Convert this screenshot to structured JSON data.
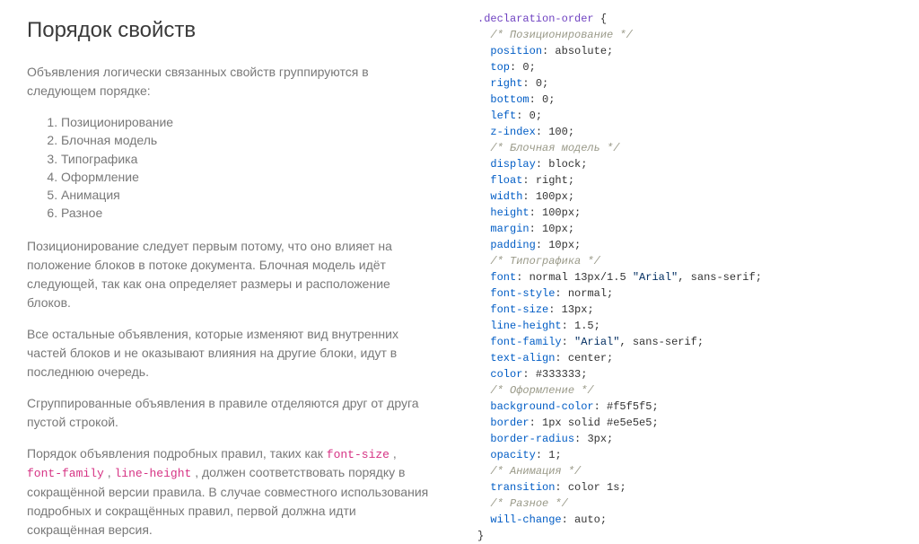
{
  "left": {
    "title": "Порядок свойств",
    "intro": "Объявления логически связанных свойств группируются в следующем порядке:",
    "order_list": [
      "Позиционирование",
      "Блочная модель",
      "Типографика",
      "Оформление",
      "Анимация",
      "Разное"
    ],
    "para_positioning": "Позиционирование следует первым потому, что оно влияет на положение блоков в потоке документа. Блочная модель идёт следующей, так как она определяет размеры и расположение блоков.",
    "para_other": "Все остальные объявления, которые изменяют вид внутренних частей блоков и не оказывают влияния на другие блоки, идут в последнюю очередь.",
    "para_grouped": "Сгруппированные объявления в правиле отделяются друг от друга пустой строкой.",
    "para_shorthand_1": "Порядок объявления подробных правил, таких как ",
    "code_font_size": "font-size",
    "sep_comma_space": " , ",
    "code_font_family": "font-family",
    "code_line_height": "line-height",
    "para_shorthand_2": " , должен соответствовать порядку в сокращённой версии правила. В случае совместного использования подробных и сокращённых правил, первой должна идти сокращённая версия."
  },
  "code": {
    "selector": ".declaration-order",
    "open_brace": "{",
    "close_brace": "}",
    "indent": "  ",
    "sections": [
      {
        "comment": "/* Позиционирование */",
        "declarations": [
          {
            "prop": "position",
            "value_parts": [
              {
                "type": "plain",
                "text": "absolute"
              }
            ]
          },
          {
            "prop": "top",
            "value_parts": [
              {
                "type": "plain",
                "text": "0"
              }
            ]
          },
          {
            "prop": "right",
            "value_parts": [
              {
                "type": "plain",
                "text": "0"
              }
            ]
          },
          {
            "prop": "bottom",
            "value_parts": [
              {
                "type": "plain",
                "text": "0"
              }
            ]
          },
          {
            "prop": "left",
            "value_parts": [
              {
                "type": "plain",
                "text": "0"
              }
            ]
          },
          {
            "prop": "z-index",
            "value_parts": [
              {
                "type": "plain",
                "text": "100"
              }
            ]
          }
        ]
      },
      {
        "comment": "/* Блочная модель */",
        "declarations": [
          {
            "prop": "display",
            "value_parts": [
              {
                "type": "plain",
                "text": "block"
              }
            ]
          },
          {
            "prop": "float",
            "value_parts": [
              {
                "type": "plain",
                "text": "right"
              }
            ]
          },
          {
            "prop": "width",
            "value_parts": [
              {
                "type": "plain",
                "text": "100px"
              }
            ]
          },
          {
            "prop": "height",
            "value_parts": [
              {
                "type": "plain",
                "text": "100px"
              }
            ]
          },
          {
            "prop": "margin",
            "value_parts": [
              {
                "type": "plain",
                "text": "10px"
              }
            ]
          },
          {
            "prop": "padding",
            "value_parts": [
              {
                "type": "plain",
                "text": "10px"
              }
            ]
          }
        ]
      },
      {
        "comment": "/* Типографика */",
        "declarations": [
          {
            "prop": "font",
            "value_parts": [
              {
                "type": "plain",
                "text": "normal 13px/1.5 "
              },
              {
                "type": "string",
                "text": "\"Arial\""
              },
              {
                "type": "plain",
                "text": ", sans-serif"
              }
            ]
          },
          {
            "prop": "font-style",
            "value_parts": [
              {
                "type": "plain",
                "text": "normal"
              }
            ]
          },
          {
            "prop": "font-size",
            "value_parts": [
              {
                "type": "plain",
                "text": "13px"
              }
            ]
          },
          {
            "prop": "line-height",
            "value_parts": [
              {
                "type": "plain",
                "text": "1.5"
              }
            ]
          },
          {
            "prop": "font-family",
            "value_parts": [
              {
                "type": "string",
                "text": "\"Arial\""
              },
              {
                "type": "plain",
                "text": ", sans-serif"
              }
            ]
          },
          {
            "prop": "text-align",
            "value_parts": [
              {
                "type": "plain",
                "text": "center"
              }
            ]
          },
          {
            "prop": "color",
            "value_parts": [
              {
                "type": "plain",
                "text": "#333333"
              }
            ]
          }
        ]
      },
      {
        "comment": "/* Оформление */",
        "declarations": [
          {
            "prop": "background-color",
            "value_parts": [
              {
                "type": "plain",
                "text": "#f5f5f5"
              }
            ]
          },
          {
            "prop": "border",
            "value_parts": [
              {
                "type": "plain",
                "text": "1px solid #e5e5e5"
              }
            ]
          },
          {
            "prop": "border-radius",
            "value_parts": [
              {
                "type": "plain",
                "text": "3px"
              }
            ]
          },
          {
            "prop": "opacity",
            "value_parts": [
              {
                "type": "plain",
                "text": "1"
              }
            ]
          }
        ]
      },
      {
        "comment": "/* Анимация */",
        "declarations": [
          {
            "prop": "transition",
            "value_parts": [
              {
                "type": "plain",
                "text": "color 1s"
              }
            ]
          }
        ]
      },
      {
        "comment": "/* Разное */",
        "declarations": [
          {
            "prop": "will-change",
            "value_parts": [
              {
                "type": "plain",
                "text": "auto"
              }
            ]
          }
        ]
      }
    ]
  }
}
